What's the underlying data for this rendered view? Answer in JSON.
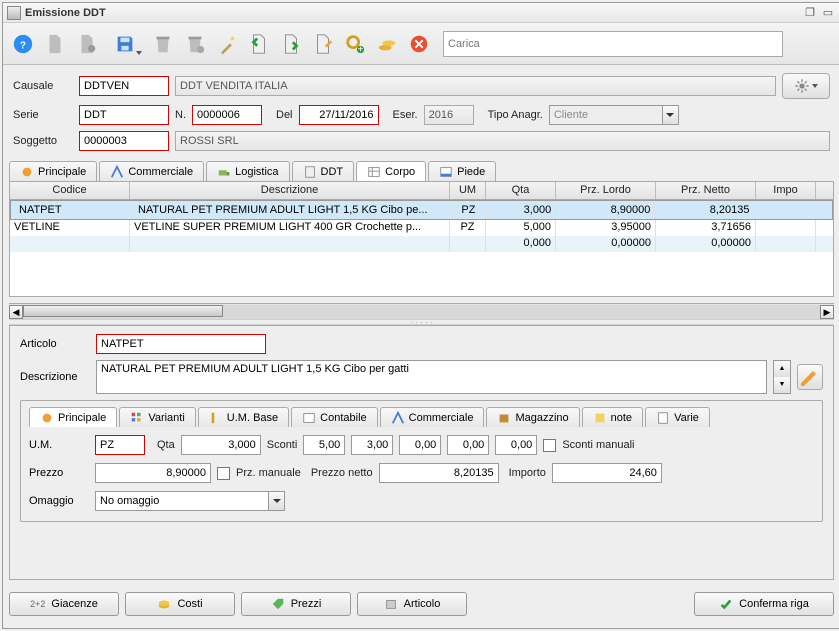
{
  "window": {
    "title": "Emissione DDT"
  },
  "toolbar": {
    "carica_placeholder": "Carica",
    "icons": [
      "help",
      "new",
      "new2",
      "save",
      "trash",
      "trash2",
      "wand",
      "open",
      "export",
      "edit",
      "search",
      "coins",
      "close"
    ]
  },
  "header": {
    "causale_label": "Causale",
    "causale_value": "DDTVEN",
    "causale_desc": "DDT VENDITA ITALIA",
    "serie_label": "Serie",
    "serie_value": "DDT",
    "numero_label": "N.",
    "numero_value": "0000006",
    "del_label": "Del",
    "del_value": "27/11/2016",
    "eser_label": "Eser.",
    "eser_value": "2016",
    "tipoanagr_label": "Tipo Anagr.",
    "tipoanagr_value": "Cliente",
    "soggetto_label": "Soggetto",
    "soggetto_value": "0000003",
    "soggetto_desc": "ROSSI SRL"
  },
  "tabs_top": [
    {
      "label": "Principale"
    },
    {
      "label": "Commerciale"
    },
    {
      "label": "Logistica"
    },
    {
      "label": "DDT"
    },
    {
      "label": "Corpo",
      "active": true
    },
    {
      "label": "Piede"
    }
  ],
  "grid": {
    "cols": {
      "codice": "Codice",
      "descrizione": "Descrizione",
      "um": "UM",
      "qta": "Qta",
      "przlordo": "Prz. Lordo",
      "prznetto": "Prz. Netto",
      "importo": "Impo"
    },
    "rows": [
      {
        "codice": "NATPET",
        "descrizione": "NATURAL PET PREMIUM ADULT LIGHT 1,5 KG Cibo pe...",
        "um": "PZ",
        "qta": "3,000",
        "przlordo": "8,90000",
        "prznetto": "8,20135"
      },
      {
        "codice": "VETLINE",
        "descrizione": "VETLINE SUPER PREMIUM LIGHT 400 GR Crochette p...",
        "um": "PZ",
        "qta": "5,000",
        "przlordo": "3,95000",
        "prznetto": "3,71656"
      },
      {
        "codice": "",
        "descrizione": "",
        "um": "",
        "qta": "0,000",
        "przlordo": "0,00000",
        "prznetto": "0,00000"
      }
    ]
  },
  "detail": {
    "articolo_label": "Articolo",
    "articolo_value": "NATPET",
    "descrizione_label": "Descrizione",
    "descrizione_value": "NATURAL PET PREMIUM ADULT LIGHT 1,5 KG Cibo per gatti",
    "tabs": [
      {
        "label": "Principale",
        "active": true
      },
      {
        "label": "Varianti"
      },
      {
        "label": "U.M. Base"
      },
      {
        "label": "Contabile"
      },
      {
        "label": "Commerciale"
      },
      {
        "label": "Magazzino"
      },
      {
        "label": "note"
      },
      {
        "label": "Varie"
      }
    ],
    "um_label": "U.M.",
    "um_value": "PZ",
    "qta_label": "Qta",
    "qta_value": "3,000",
    "sconti_label": "Sconti",
    "sconti": [
      "5,00",
      "3,00",
      "0,00",
      "0,00",
      "0,00"
    ],
    "sconti_man_label": "Sconti manuali",
    "prezzo_label": "Prezzo",
    "prezzo_value": "8,90000",
    "prz_man_label": "Prz. manuale",
    "prezzo_netto_label": "Prezzo netto",
    "prezzo_netto_value": "8,20135",
    "importo_label": "Importo",
    "importo_value": "24,60",
    "omaggio_label": "Omaggio",
    "omaggio_value": "No omaggio"
  },
  "footer": {
    "giacenze": "Giacenze",
    "giacenze_prefix": "2+2",
    "costi": "Costi",
    "prezzi": "Prezzi",
    "articolo": "Articolo",
    "conferma": "Conferma riga"
  }
}
